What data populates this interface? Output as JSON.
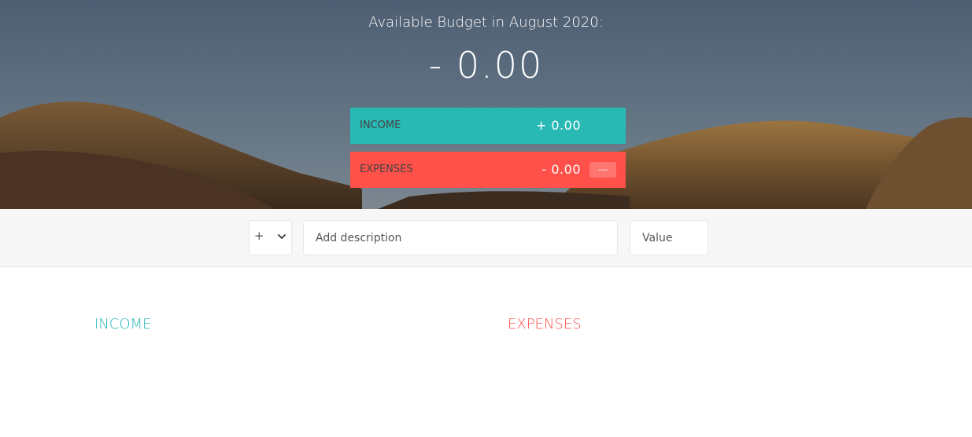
{
  "budget": {
    "title": "Available Budget in August 2020:",
    "value": "- 0.00",
    "income": {
      "label": "Income",
      "value": "+ 0.00"
    },
    "expenses": {
      "label": "Expenses",
      "value": "- 0.00",
      "percentage": "---"
    }
  },
  "add": {
    "type_selected": "+",
    "description_placeholder": "Add description",
    "value_placeholder": "Value"
  },
  "lists": {
    "income_title": "Income",
    "expenses_title": "Expenses"
  },
  "colors": {
    "income": "#28B9B5",
    "expenses": "#FF5049"
  },
  "icons": {
    "type_dropdown": "chevron-down-icon"
  }
}
